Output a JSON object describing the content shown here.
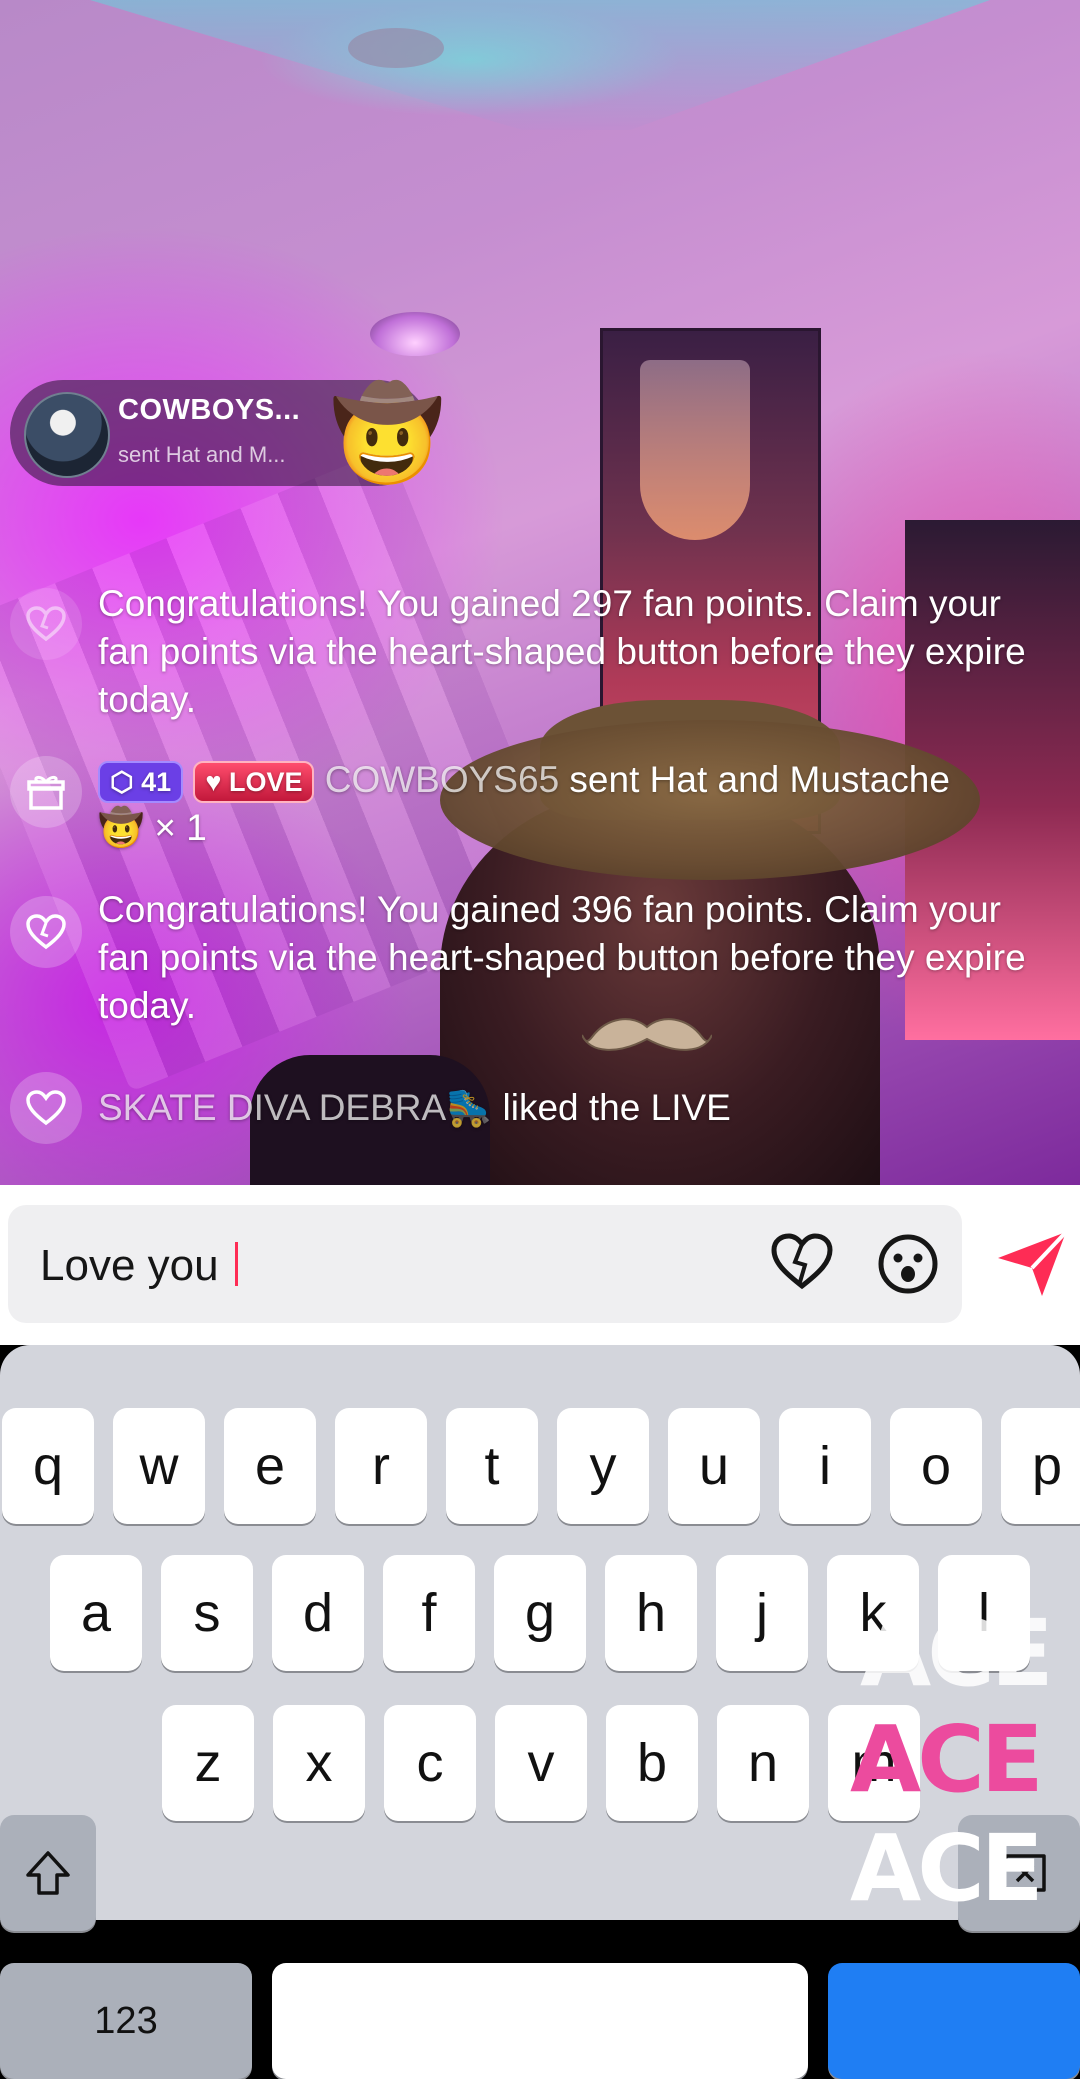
{
  "gift_banner": {
    "sender": "COWBOYS...",
    "message": "sent Hat and M...",
    "gift_emoji": "🤠"
  },
  "chat": [
    {
      "type": "system",
      "icon": "heart-outline-icon",
      "text": "Congratulations! You gained 297 fan points. Claim your fan points via the heart-shaped button before they expire today."
    },
    {
      "type": "gift",
      "icon": "gift-icon",
      "level_badge": "41",
      "fan_badge": "LOVE",
      "username": "COWBOYS65",
      "text": " sent Hat and Mustache",
      "gift_emoji": "🤠",
      "count": "× 1"
    },
    {
      "type": "system",
      "icon": "heart-outline-icon",
      "text": "Congratulations! You gained 396 fan points. Claim your fan points via the heart-shaped button before they expire today."
    },
    {
      "type": "like",
      "icon": "heart-icon",
      "username": "SKATE DIVA DEBRA🛼",
      "text": " liked the LIVE"
    }
  ],
  "composer": {
    "input_value": "Love you "
  },
  "keyboard": {
    "row1": [
      "q",
      "w",
      "e",
      "r",
      "t",
      "y",
      "u",
      "i",
      "o",
      "p"
    ],
    "row2": [
      "a",
      "s",
      "d",
      "f",
      "g",
      "h",
      "j",
      "k",
      "l"
    ],
    "row3": [
      "z",
      "x",
      "c",
      "v",
      "b",
      "n",
      "m"
    ],
    "numbers_key": "123"
  },
  "watermark": {
    "text": "ACE"
  },
  "colors": {
    "accent": "#fe2c55",
    "keyboard_bg": "#d3d5dc",
    "return_key": "#1f7ef3",
    "watermark_pink": "#ec4b9e"
  }
}
